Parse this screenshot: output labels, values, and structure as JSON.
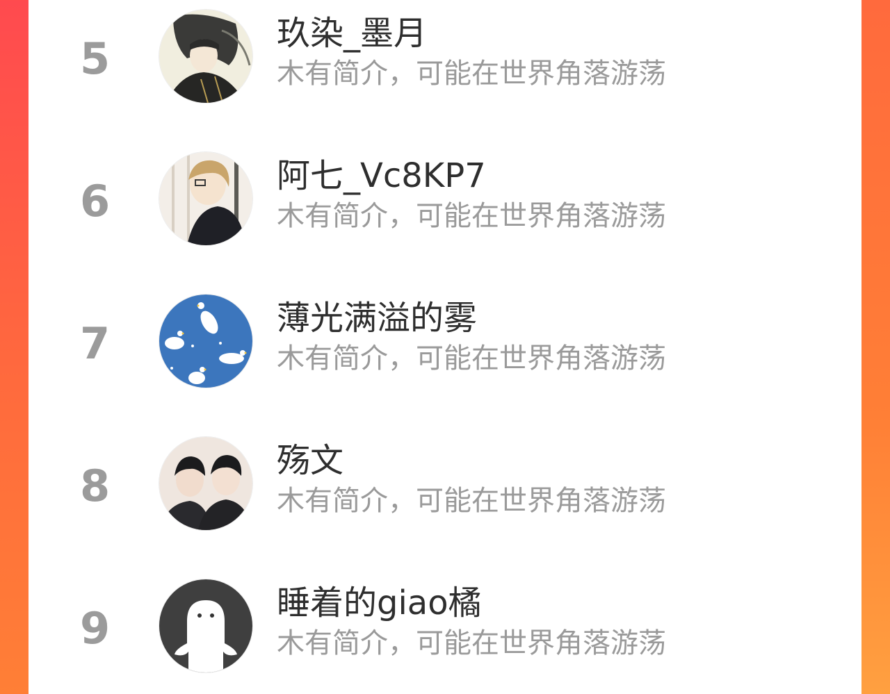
{
  "ranking_list": {
    "rows": [
      {
        "rank": "5",
        "name": "玖染_墨月",
        "bio": "木有简介，可能在世界角落游荡",
        "avatar_icon": "avatar-ink-painting"
      },
      {
        "rank": "6",
        "name": "阿七_Vc8KP7",
        "bio": "木有简介，可能在世界角落游荡",
        "avatar_icon": "avatar-anime-character"
      },
      {
        "rank": "7",
        "name": "薄光满溢的雾",
        "bio": "木有简介，可能在世界角落游荡",
        "avatar_icon": "avatar-geese-pattern"
      },
      {
        "rank": "8",
        "name": "殇文",
        "bio": "木有简介，可能在世界角落游荡",
        "avatar_icon": "avatar-two-people-photo"
      },
      {
        "rank": "9",
        "name": "睡着的giao橘",
        "bio": "木有简介，可能在世界角落游荡",
        "avatar_icon": "avatar-default-ghost"
      }
    ]
  },
  "colors": {
    "background_gradient_start": "#ff4a4f",
    "background_gradient_end": "#ff7f36",
    "rank_text": "#9b9b9b",
    "name_text": "#2e2e2e",
    "bio_text": "#9a9a9a"
  }
}
